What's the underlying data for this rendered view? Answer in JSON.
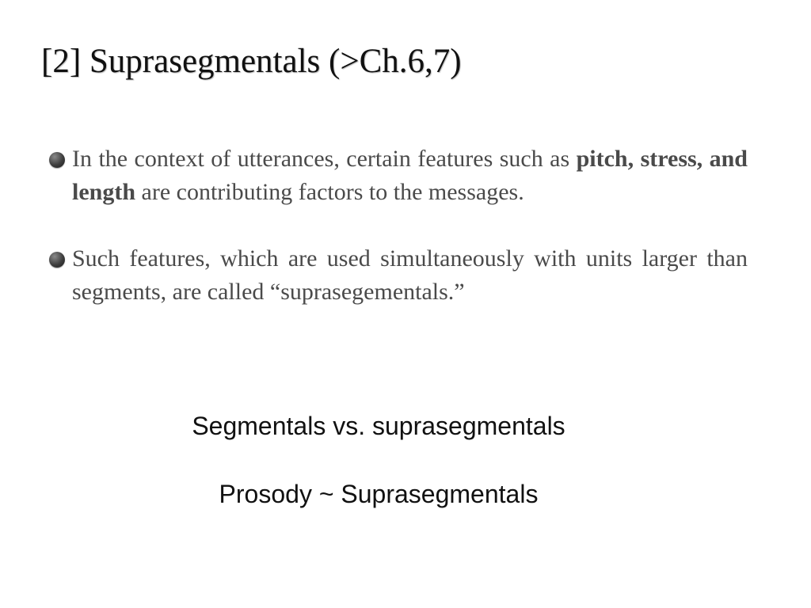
{
  "slide": {
    "title": "[2] Suprasegmentals (>Ch.6,7)",
    "bullets": [
      {
        "text_before": "In the context of utterances, certain features such as ",
        "bold": "pitch, stress, and length",
        "text_after": " are contributing factors to the messages."
      },
      {
        "text_before": "Such features, which are used simultaneously with units larger than segments, are called “suprasegementals.”",
        "bold": "",
        "text_after": ""
      }
    ],
    "center_lines": [
      "Segmentals vs. suprasegmentals",
      "Prosody ~ Suprasegmentals"
    ]
  }
}
